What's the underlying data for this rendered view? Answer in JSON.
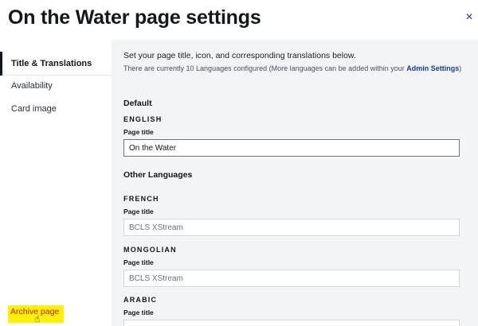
{
  "header": {
    "title": "On the Water page settings",
    "close_label": "×"
  },
  "sidebar": {
    "items": [
      {
        "label": "Title & Translations",
        "active": true
      },
      {
        "label": "Availability",
        "active": false
      },
      {
        "label": "Card image",
        "active": false
      }
    ],
    "archive_label": "Archive page"
  },
  "main": {
    "intro": "Set your page title, icon, and corresponding translations below.",
    "note_prefix": "There are currently 10 Languages configured (More languages can be added within your ",
    "note_link": "Admin Settings",
    "note_suffix": ")",
    "default_heading": "Default",
    "other_heading": "Other Languages",
    "page_title_label": "Page title",
    "languages": [
      {
        "name": "ENGLISH",
        "value": "On the Water"
      },
      {
        "name": "FRENCH",
        "value": "BCLS XStream"
      },
      {
        "name": "MONGOLIAN",
        "value": "BCLS XStream"
      },
      {
        "name": "ARABIC",
        "value": ""
      }
    ]
  }
}
